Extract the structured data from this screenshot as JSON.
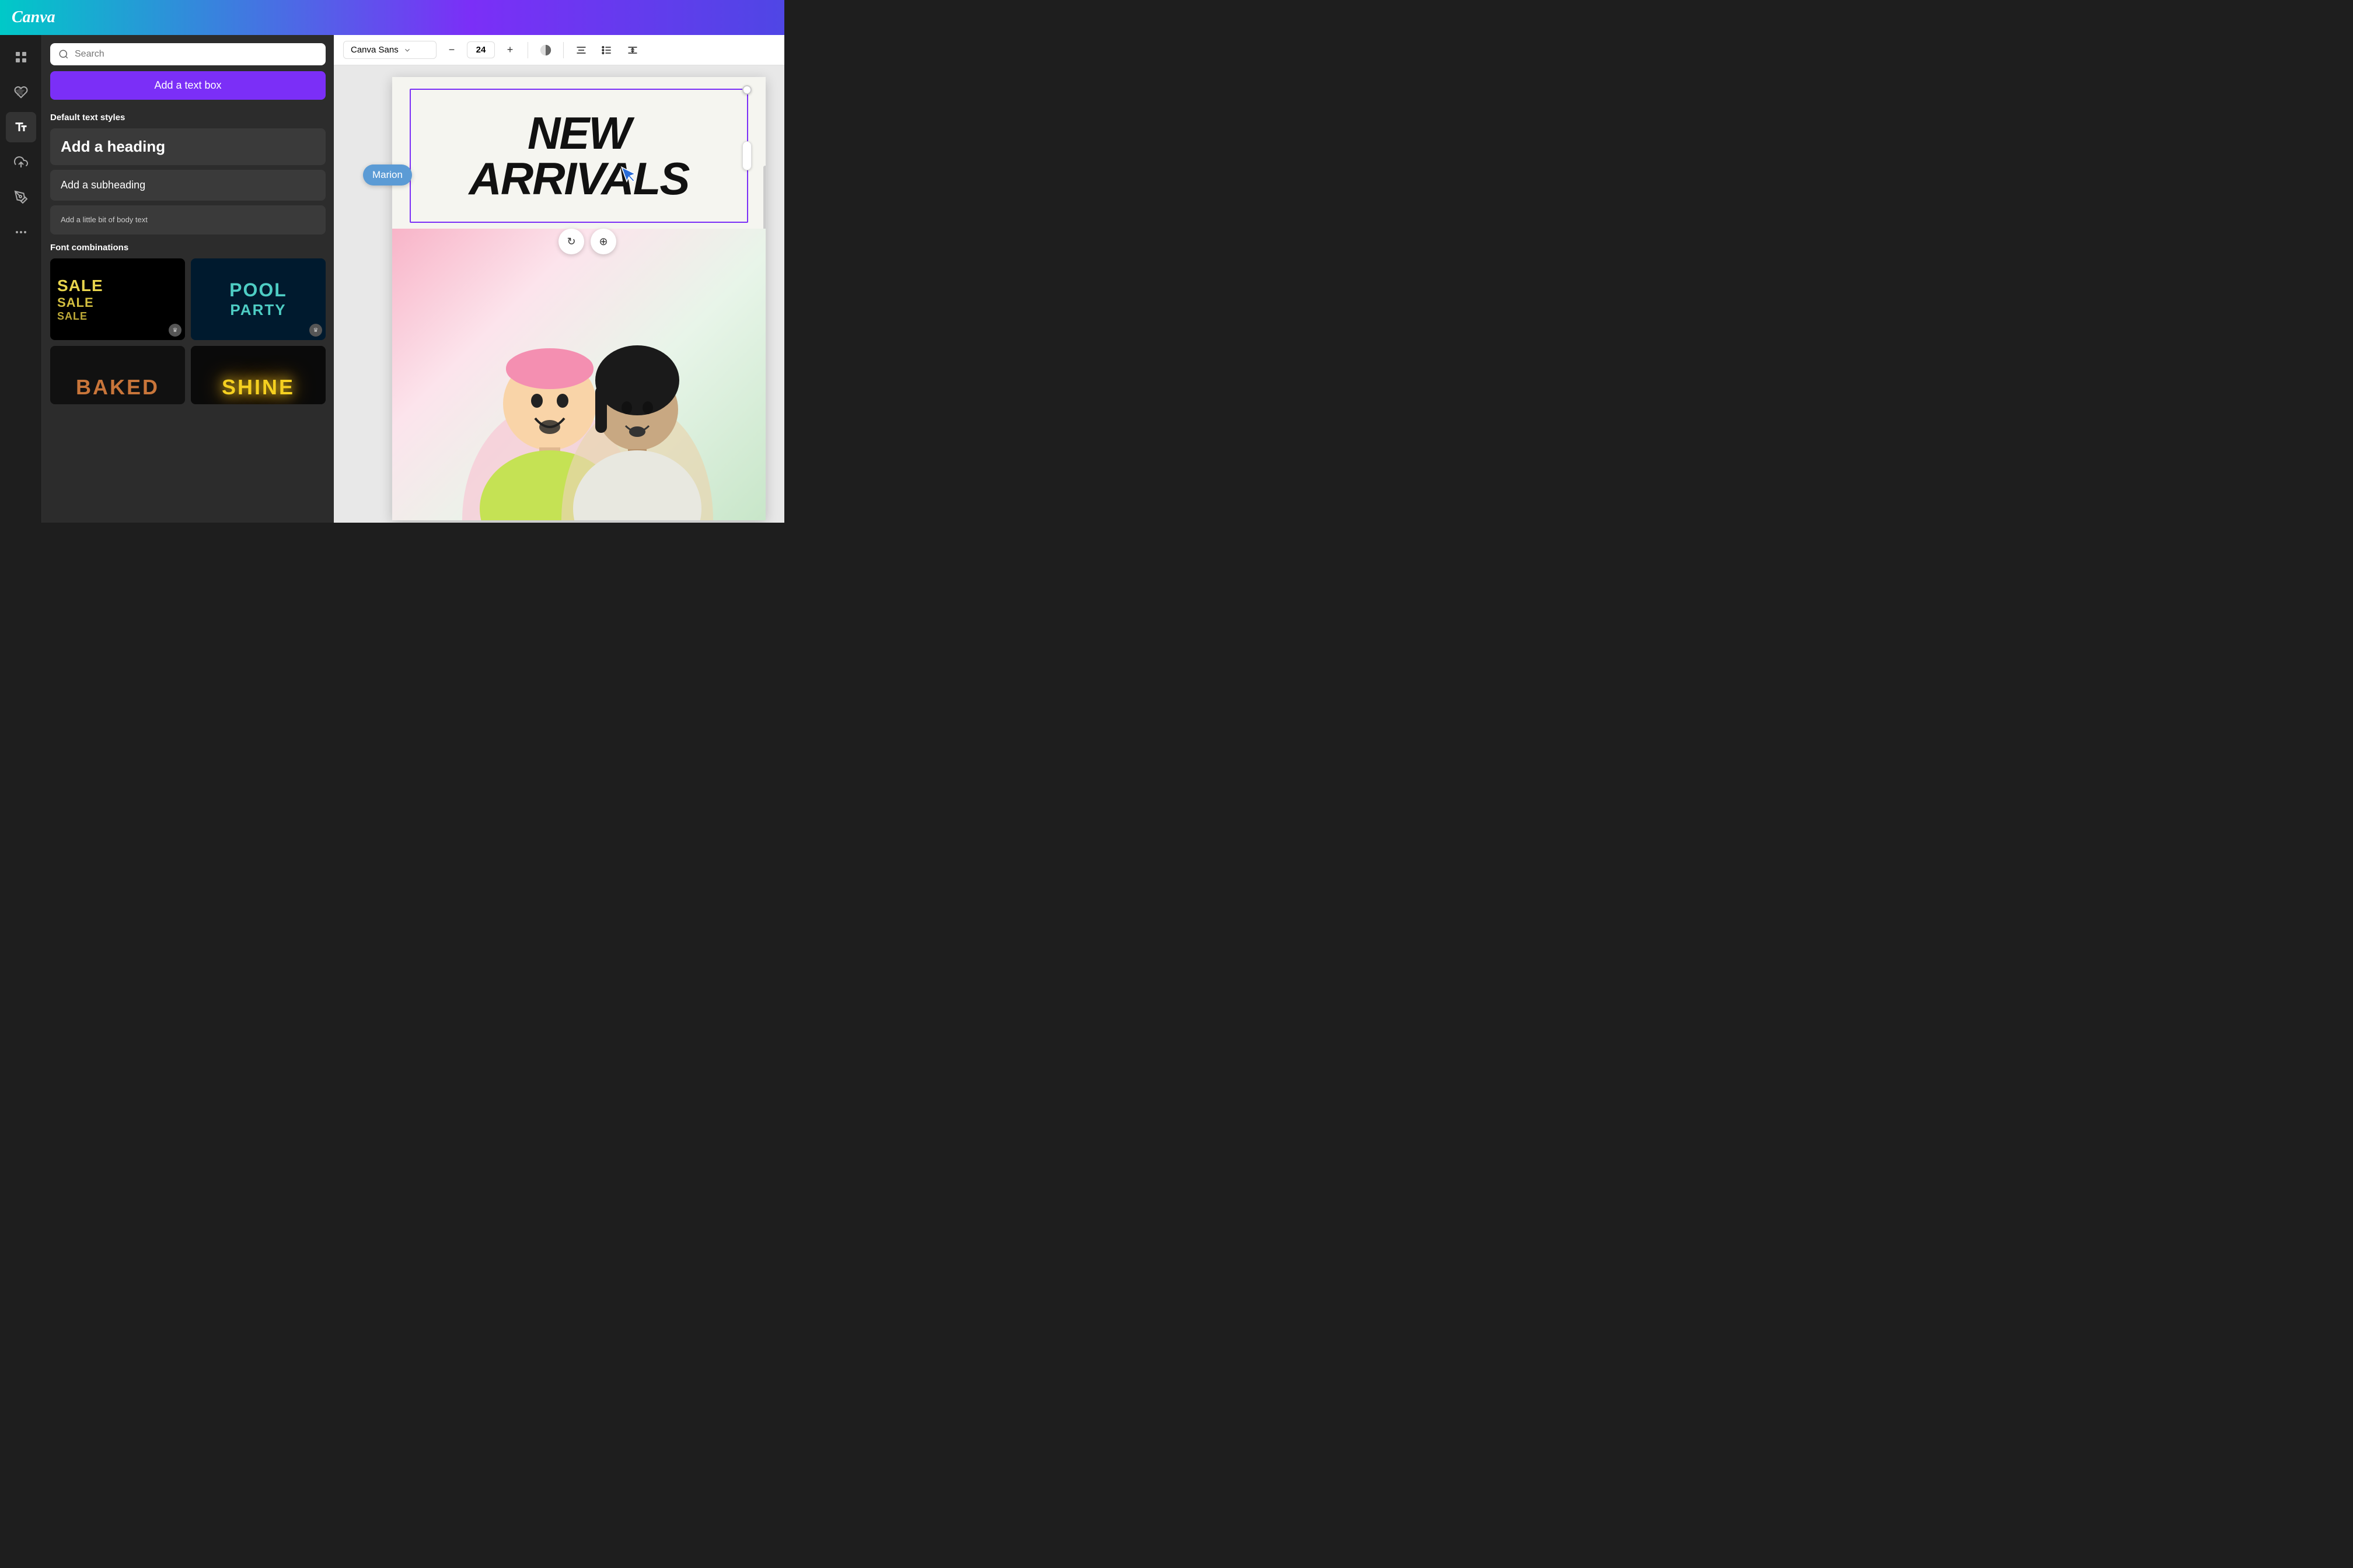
{
  "app": {
    "name": "Canva"
  },
  "toolbar": {
    "font_family": "Canva Sans",
    "font_size": "24",
    "decrease_label": "−",
    "increase_label": "+",
    "dropdown_arrow": "▾"
  },
  "left_panel": {
    "search_placeholder": "Search",
    "add_text_box_label": "Add a text box",
    "section_default_styles": "Default text styles",
    "heading_label": "Add a heading",
    "subheading_label": "Add a subheading",
    "body_label": "Add a little bit of body text",
    "section_font_combos": "Font combinations",
    "combos": [
      {
        "id": "sale",
        "lines": [
          "SALE",
          "SALE",
          "SALE"
        ]
      },
      {
        "id": "pool-party",
        "lines": [
          "POOL",
          "PARTY"
        ]
      },
      {
        "id": "baked",
        "lines": [
          "BAKED"
        ]
      },
      {
        "id": "shine",
        "lines": [
          "SHINE"
        ]
      }
    ]
  },
  "canvas": {
    "text_content": "NEW\nARRIVALS"
  },
  "tooltip": {
    "label": "Marion"
  },
  "icons": {
    "search": "🔍",
    "grid": "⊞",
    "elements": "♥△",
    "text": "T",
    "upload": "↑",
    "draw": "✏",
    "apps": "⋯",
    "align_center": "≡",
    "align_list": "≣",
    "spacing": "↕",
    "style": "◐",
    "crown": "♛",
    "rotate": "↻",
    "move": "⊕"
  }
}
